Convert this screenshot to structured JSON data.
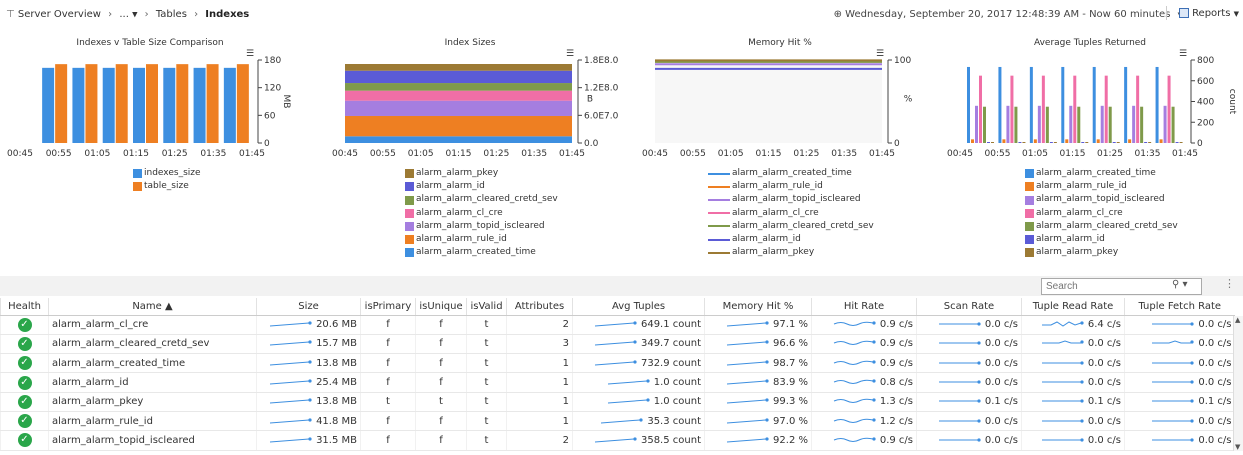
{
  "breadcrumb": {
    "items": [
      "Server Overview",
      "...",
      "Tables",
      "Indexes"
    ]
  },
  "header": {
    "time_text": "Wednesday, September 20, 2017 12:48:39 AM - Now 60 minutes",
    "reports_label": "Reports"
  },
  "colors": {
    "blue": "#3d8fe0",
    "orange": "#ee7f22",
    "brown": "#9c7a34",
    "indigo": "#5b5bd6",
    "olive": "#7f9a4a",
    "pink": "#f06ea6",
    "purple": "#a57ee0",
    "health_ok": "#2aa64a"
  },
  "charts": [
    {
      "title": "Indexes v Table Size Comparison",
      "legend": [
        "indexes_size",
        "table_size"
      ]
    },
    {
      "title": "Index Sizes",
      "legend": [
        "alarm_alarm_pkey",
        "alarm_alarm_id",
        "alarm_alarm_cleared_cretd_sev",
        "alarm_alarm_cl_cre",
        "alarm_alarm_topid_iscleared",
        "alarm_alarm_rule_id",
        "alarm_alarm_created_time"
      ]
    },
    {
      "title": "Memory Hit %",
      "legend": [
        "alarm_alarm_created_time",
        "alarm_alarm_rule_id",
        "alarm_alarm_topid_iscleared",
        "alarm_alarm_cl_cre",
        "alarm_alarm_cleared_cretd_sev",
        "alarm_alarm_id",
        "alarm_alarm_pkey"
      ]
    },
    {
      "title": "Average Tuples Returned",
      "legend": [
        "alarm_alarm_created_time",
        "alarm_alarm_rule_id",
        "alarm_alarm_topid_iscleared",
        "alarm_alarm_cl_cre",
        "alarm_alarm_cleared_cretd_sev",
        "alarm_alarm_id",
        "alarm_alarm_pkey"
      ]
    }
  ],
  "chart_data": [
    {
      "type": "bar",
      "title": "Indexes v Table Size Comparison",
      "xlabel": "",
      "ylabel": "MB",
      "ylim": [
        0,
        180
      ],
      "yticks": [
        "180",
        "120",
        "60",
        "0"
      ],
      "xticks": [
        "00:45",
        "00:55",
        "01:05",
        "01:15",
        "01:25",
        "01:35",
        "01:45"
      ],
      "categories": [
        "00:45",
        "00:55",
        "01:05",
        "01:15",
        "01:25",
        "01:35",
        "01:45"
      ],
      "series": [
        {
          "name": "indexes_size",
          "values": [
            163,
            163,
            163,
            163,
            163,
            163,
            163
          ]
        },
        {
          "name": "table_size",
          "values": [
            171,
            171,
            171,
            171,
            171,
            171,
            171
          ]
        }
      ],
      "legend_position": "bottom"
    },
    {
      "type": "area",
      "title": "Index Sizes",
      "xlabel": "",
      "ylabel": "B",
      "ylim": [
        0,
        180000000
      ],
      "yticks": [
        "1.8E8.0",
        "1.2E8.0",
        "6.0E7.0",
        "0.0"
      ],
      "xticks": [
        "00:45",
        "00:55",
        "01:05",
        "01:15",
        "01:25",
        "01:35",
        "01:45"
      ],
      "stacked": true,
      "series": [
        {
          "name": "alarm_alarm_created_time",
          "value_mb": 13.8
        },
        {
          "name": "alarm_alarm_rule_id",
          "value_mb": 41.8
        },
        {
          "name": "alarm_alarm_topid_iscleared",
          "value_mb": 31.5
        },
        {
          "name": "alarm_alarm_cl_cre",
          "value_mb": 20.6
        },
        {
          "name": "alarm_alarm_cleared_cretd_sev",
          "value_mb": 15.7
        },
        {
          "name": "alarm_alarm_id",
          "value_mb": 25.4
        },
        {
          "name": "alarm_alarm_pkey",
          "value_mb": 13.8
        }
      ],
      "legend_position": "bottom"
    },
    {
      "type": "line",
      "title": "Memory Hit %",
      "xlabel": "",
      "ylabel": "%",
      "ylim": [
        0,
        100
      ],
      "yticks": [
        "100",
        "0"
      ],
      "xticks": [
        "00:45",
        "00:55",
        "01:05",
        "01:15",
        "01:25",
        "01:35",
        "01:45"
      ],
      "series": [
        {
          "name": "alarm_alarm_created_time",
          "value": 98.7
        },
        {
          "name": "alarm_alarm_rule_id",
          "value": 97.0
        },
        {
          "name": "alarm_alarm_topid_iscleared",
          "value": 92.2
        },
        {
          "name": "alarm_alarm_cl_cre",
          "value": 97.1
        },
        {
          "name": "alarm_alarm_cleared_cretd_sev",
          "value": 96.6
        },
        {
          "name": "alarm_alarm_id",
          "value": 83.9
        },
        {
          "name": "alarm_alarm_pkey",
          "value": 99.3
        }
      ],
      "legend_position": "bottom"
    },
    {
      "type": "bar",
      "title": "Average Tuples Returned",
      "xlabel": "",
      "ylabel": "count",
      "ylim": [
        0,
        800
      ],
      "yticks": [
        "800",
        "600",
        "400",
        "200",
        "0"
      ],
      "xticks": [
        "00:45",
        "00:55",
        "01:05",
        "01:15",
        "01:25",
        "01:35",
        "01:45"
      ],
      "categories": [
        "00:45",
        "00:55",
        "01:05",
        "01:15",
        "01:25",
        "01:35",
        "01:45"
      ],
      "series": [
        {
          "name": "alarm_alarm_created_time",
          "value": 732.9
        },
        {
          "name": "alarm_alarm_rule_id",
          "value": 35.3
        },
        {
          "name": "alarm_alarm_topid_iscleared",
          "value": 358.5
        },
        {
          "name": "alarm_alarm_cl_cre",
          "value": 649.1
        },
        {
          "name": "alarm_alarm_cleared_cretd_sev",
          "value": 349.7
        },
        {
          "name": "alarm_alarm_id",
          "value": 1.0
        },
        {
          "name": "alarm_alarm_pkey",
          "value": 1.0
        }
      ],
      "legend_position": "bottom"
    }
  ],
  "grid": {
    "search_placeholder": "Search",
    "columns": [
      "Health",
      "Name ▲",
      "Size",
      "isPrimary",
      "isUnique",
      "isValid",
      "Attributes",
      "Avg Tuples",
      "Memory Hit %",
      "Hit Rate",
      "Scan Rate",
      "Tuple Read Rate",
      "Tuple Fetch Rate"
    ],
    "rows": [
      {
        "name": "alarm_alarm_cl_cre",
        "size": "20.6 MB",
        "is_primary": "f",
        "is_unique": "f",
        "is_valid": "t",
        "attributes": "2",
        "avg_tuples": "649.1 count",
        "memory_hit": "97.1 %",
        "hit_rate": "0.9 c/s",
        "scan_rate": "0.0 c/s",
        "tuple_read_rate": "6.4 c/s",
        "tuple_fetch_rate": "0.0 c/s"
      },
      {
        "name": "alarm_alarm_cleared_cretd_sev",
        "size": "15.7 MB",
        "is_primary": "f",
        "is_unique": "f",
        "is_valid": "t",
        "attributes": "3",
        "avg_tuples": "349.7 count",
        "memory_hit": "96.6 %",
        "hit_rate": "0.9 c/s",
        "scan_rate": "0.0 c/s",
        "tuple_read_rate": "0.0 c/s",
        "tuple_fetch_rate": "0.0 c/s"
      },
      {
        "name": "alarm_alarm_created_time",
        "size": "13.8 MB",
        "is_primary": "f",
        "is_unique": "f",
        "is_valid": "t",
        "attributes": "1",
        "avg_tuples": "732.9 count",
        "memory_hit": "98.7 %",
        "hit_rate": "0.9 c/s",
        "scan_rate": "0.0 c/s",
        "tuple_read_rate": "0.0 c/s",
        "tuple_fetch_rate": "0.0 c/s"
      },
      {
        "name": "alarm_alarm_id",
        "size": "25.4 MB",
        "is_primary": "f",
        "is_unique": "f",
        "is_valid": "t",
        "attributes": "1",
        "avg_tuples": "1.0 count",
        "memory_hit": "83.9 %",
        "hit_rate": "0.8 c/s",
        "scan_rate": "0.0 c/s",
        "tuple_read_rate": "0.0 c/s",
        "tuple_fetch_rate": "0.0 c/s"
      },
      {
        "name": "alarm_alarm_pkey",
        "size": "13.8 MB",
        "is_primary": "t",
        "is_unique": "t",
        "is_valid": "t",
        "attributes": "1",
        "avg_tuples": "1.0 count",
        "memory_hit": "99.3 %",
        "hit_rate": "1.3 c/s",
        "scan_rate": "0.1 c/s",
        "tuple_read_rate": "0.1 c/s",
        "tuple_fetch_rate": "0.1 c/s"
      },
      {
        "name": "alarm_alarm_rule_id",
        "size": "41.8 MB",
        "is_primary": "f",
        "is_unique": "f",
        "is_valid": "t",
        "attributes": "1",
        "avg_tuples": "35.3 count",
        "memory_hit": "97.0 %",
        "hit_rate": "1.2 c/s",
        "scan_rate": "0.0 c/s",
        "tuple_read_rate": "0.0 c/s",
        "tuple_fetch_rate": "0.0 c/s"
      },
      {
        "name": "alarm_alarm_topid_iscleared",
        "size": "31.5 MB",
        "is_primary": "f",
        "is_unique": "f",
        "is_valid": "t",
        "attributes": "2",
        "avg_tuples": "358.5 count",
        "memory_hit": "92.2 %",
        "hit_rate": "0.9 c/s",
        "scan_rate": "0.0 c/s",
        "tuple_read_rate": "0.0 c/s",
        "tuple_fetch_rate": "0.0 c/s"
      }
    ]
  }
}
